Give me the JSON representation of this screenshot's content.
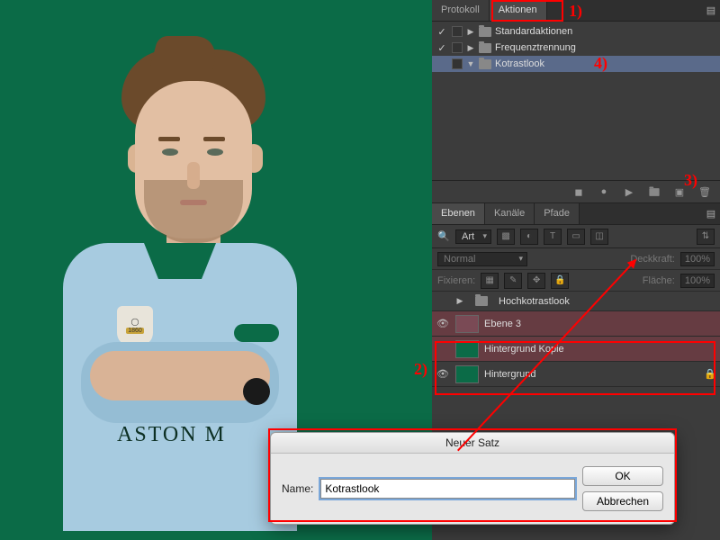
{
  "canvas": {
    "crest_year": "1860",
    "sponsor_partial": "ASTON M"
  },
  "panels": {
    "top_tabs": [
      "Protokoll",
      "Aktionen"
    ],
    "actions": {
      "items": [
        {
          "label": "Standardaktionen",
          "checked": true,
          "expanded": false
        },
        {
          "label": "Frequenztrennung",
          "checked": true,
          "expanded": false
        },
        {
          "label": "Kotrastlook",
          "checked": false,
          "expanded": true,
          "selected": true
        }
      ]
    },
    "controls": [
      "stop-icon",
      "record-icon",
      "play-icon",
      "new-set-icon",
      "new-action-icon",
      "trash-icon"
    ],
    "layers_tabs": [
      "Ebenen",
      "Kanäle",
      "Pfade"
    ],
    "filter": {
      "label": "Art",
      "icons": [
        "image-filter",
        "fx-filter",
        "text-filter",
        "shape-filter",
        "smartobj-filter"
      ],
      "switch": true
    },
    "blend": {
      "mode": "Normal",
      "opacity_label": "Deckkraft:",
      "opacity_value": "100%"
    },
    "lock": {
      "label": "Fixieren:",
      "fill_label": "Fläche:",
      "fill_value": "100%"
    },
    "layers": [
      {
        "name": "Hochkotrastlook",
        "type": "group",
        "visible": false
      },
      {
        "name": "Ebene 3",
        "type": "layer",
        "visible": true,
        "selected": true,
        "thumb": "pinkish"
      },
      {
        "name": "Hintergrund Kopie",
        "type": "layer",
        "visible": false,
        "selected": true,
        "thumb": "green-person"
      },
      {
        "name": "Hintergrund",
        "type": "layer",
        "visible": true,
        "thumb": "green-person"
      }
    ]
  },
  "dialog": {
    "title": "Neuer Satz",
    "name_label": "Name:",
    "name_value": "Kotrastlook",
    "ok": "OK",
    "cancel": "Abbrechen"
  },
  "annotations": {
    "a1": "1)",
    "a2": "2)",
    "a3": "3)",
    "a4": "4)"
  }
}
